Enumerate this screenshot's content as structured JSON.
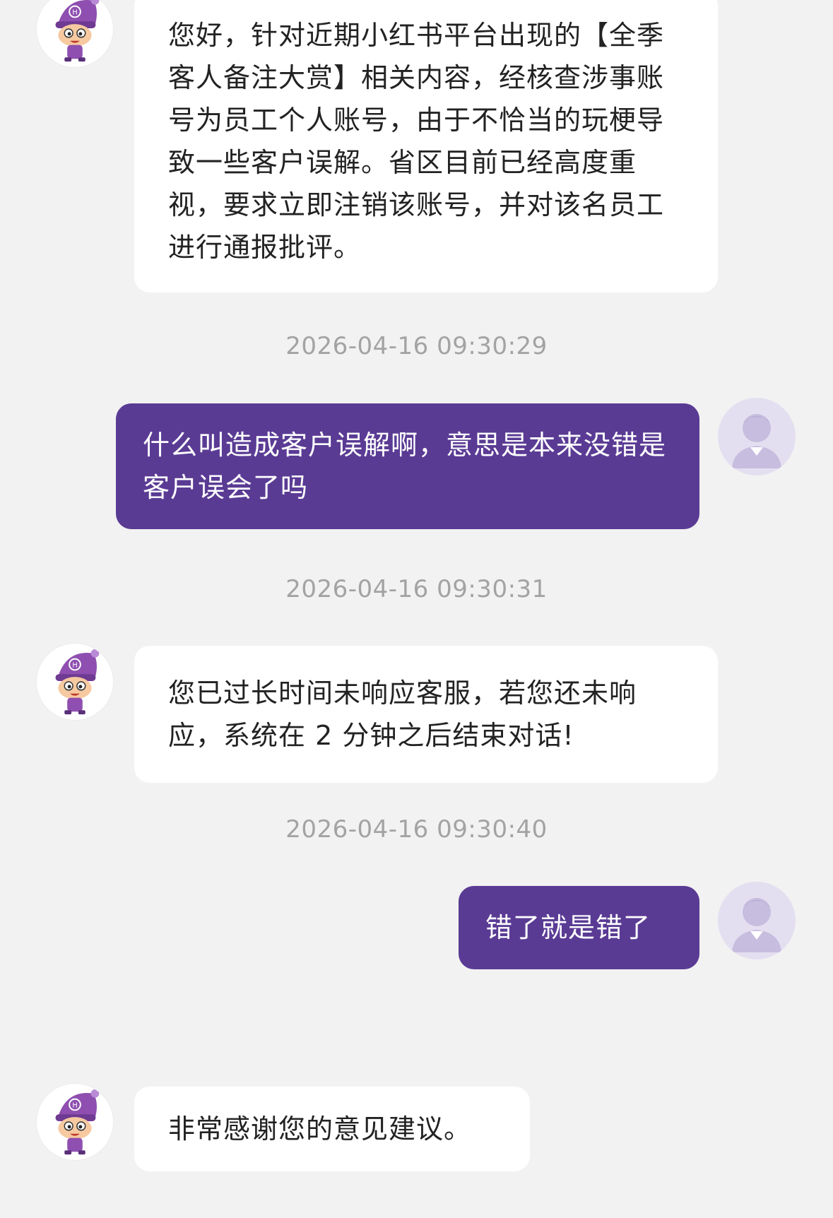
{
  "messages": [
    {
      "sender": "bot",
      "text": "您好，针对近期小红书平台出现的【全季客人备注大赏】相关内容，经核查涉事账号为员工个人账号，由于不恰当的玩梗导致一些客户误解。省区目前已经高度重视，要求立即注销该账号，并对该名员工进行通报批评。"
    },
    {
      "sender": "user",
      "timestamp": "2026-04-16 09:30:29",
      "text": "什么叫造成客户误解啊，意思是本来没错是客户误会了吗"
    },
    {
      "sender": "bot",
      "timestamp": "2026-04-16 09:30:31",
      "text": "您已过长时间未响应客服，若您还未响应，系统在 2 分钟之后结束对话!"
    },
    {
      "sender": "user",
      "timestamp": "2026-04-16 09:30:40",
      "text": "错了就是错了"
    },
    {
      "sender": "bot",
      "text": "非常感谢您的意见建议。"
    }
  ],
  "avatars": {
    "bot": "cartoon-mascot-avatar",
    "user": "default-user-avatar"
  },
  "colors": {
    "background": "#f2f2f2",
    "user_bubble": "#5a3b94",
    "bot_bubble": "#ffffff",
    "timestamp": "#a3a3a3",
    "mascot_hat": "#8e4fb0"
  }
}
